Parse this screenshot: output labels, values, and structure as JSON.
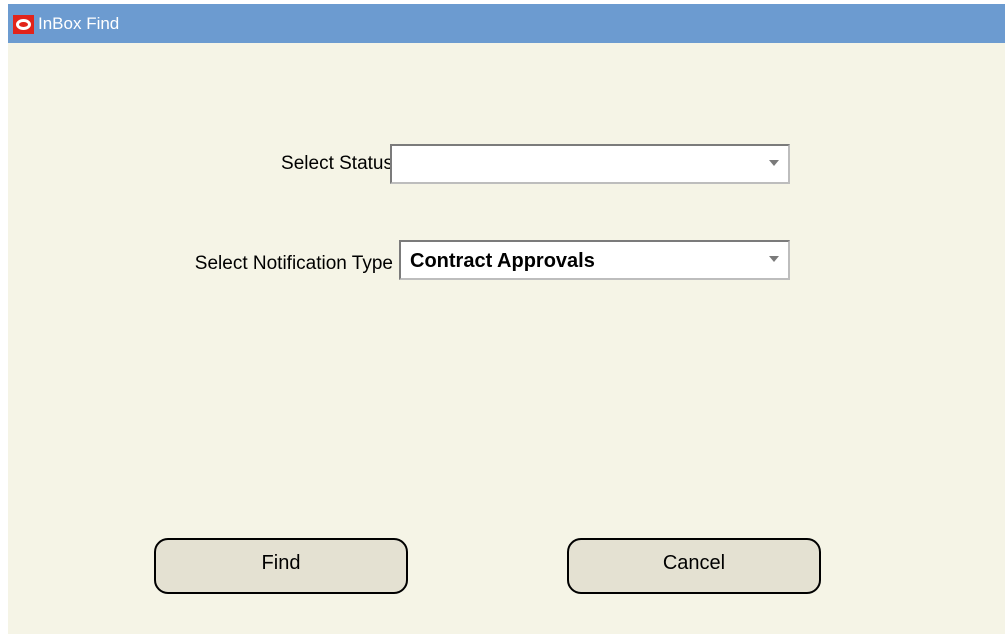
{
  "window": {
    "title": "InBox Find"
  },
  "icons": {
    "app": "oracle-logo-icon",
    "dropdown": "chevron-down-icon"
  },
  "form": {
    "status": {
      "label": "Select Status",
      "value": ""
    },
    "notification_type": {
      "label": "Select Notification Type",
      "value": "Contract Approvals"
    }
  },
  "buttons": {
    "find": "Find",
    "cancel": "Cancel"
  },
  "colors": {
    "titlebar": "#6c9bd0",
    "background": "#f5f4e6",
    "button": "#e4e1d2",
    "logo": "#e2231a"
  }
}
